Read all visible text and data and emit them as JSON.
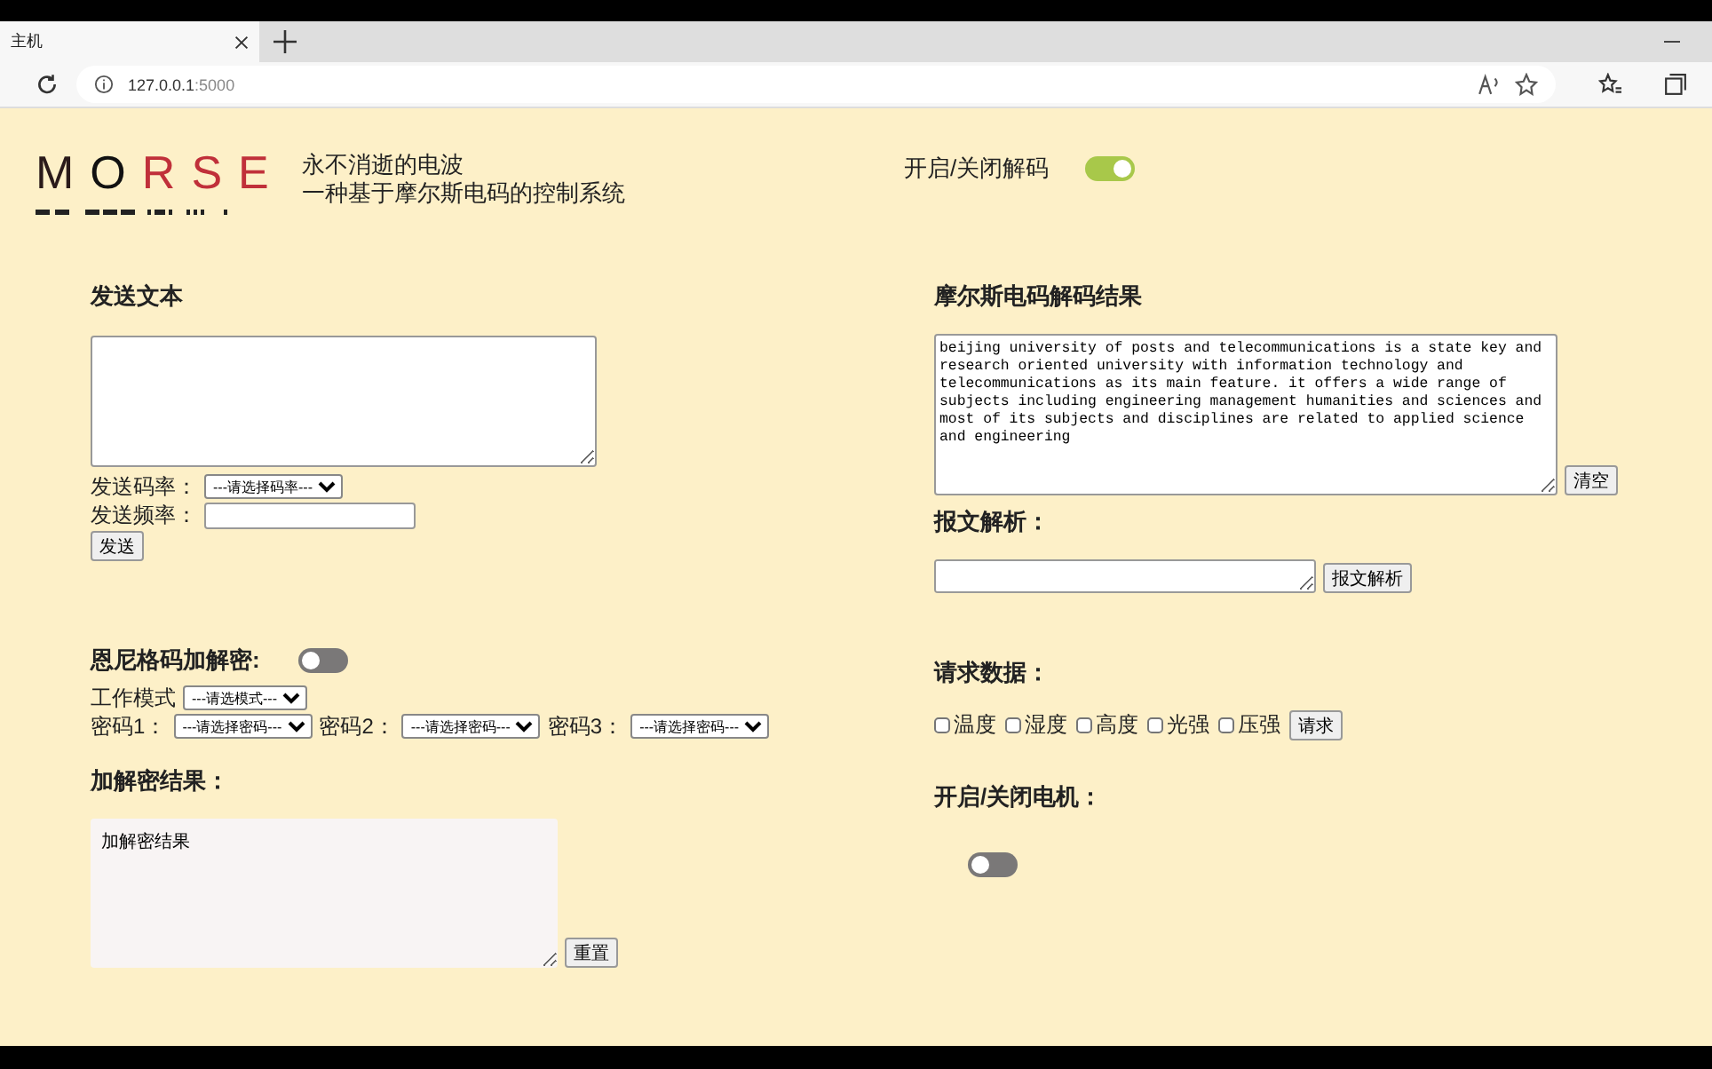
{
  "browser": {
    "tab_title": "主机",
    "url_host": "127.0.0.1",
    "url_port": ":5000"
  },
  "header": {
    "logo": [
      {
        "text": "M",
        "color": "#2a1a1a"
      },
      {
        "text": "O",
        "color": "#111111"
      },
      {
        "text": "R",
        "color": "#c0303a"
      },
      {
        "text": "S",
        "color": "#c0303a"
      },
      {
        "text": "E",
        "color": "#c0303a"
      }
    ],
    "tagline": [
      "永不消逝的电波",
      "一种基于摩尔斯电码的控制系统"
    ],
    "decode_toggle": {
      "label": "开启/关闭解码",
      "on": true
    }
  },
  "send": {
    "title": "发送文本",
    "rate_label": "发送码率：",
    "rate_select": "---请选择码率---",
    "freq_label": "发送频率：",
    "button": "发送"
  },
  "enigma": {
    "title": "恩尼格码加解密:",
    "on": false,
    "mode_label": "工作模式",
    "mode_select": "---请选模式---",
    "passwords": [
      {
        "label": "密码1：",
        "select": "---请选择密码---"
      },
      {
        "label": "密码2：",
        "select": "---请选择密码---"
      },
      {
        "label": "密码3：",
        "select": "---请选择密码---"
      }
    ],
    "result_title": "加解密结果：",
    "result_text": "加解密结果",
    "button": "重置"
  },
  "decode": {
    "title": "摩尔斯电码解码结果",
    "text": "beijing university of posts and telecommunications is a state key and research oriented university with information technology and telecommunications as its main feature. it offers a wide range of subjects including engineering management humanities and sciences and most of its subjects and disciplines are related to applied science and engineering",
    "button": "清空"
  },
  "parse": {
    "title": "报文解析：",
    "button": "报文解析"
  },
  "request": {
    "title": "请求数据：",
    "items": [
      {
        "label": "温度",
        "checked": false
      },
      {
        "label": "湿度",
        "checked": false
      },
      {
        "label": "高度",
        "checked": false
      },
      {
        "label": "光强",
        "checked": false
      },
      {
        "label": "压强",
        "checked": false
      }
    ],
    "button": "请求"
  },
  "motor": {
    "title": "开启/关闭电机：",
    "on": false
  }
}
